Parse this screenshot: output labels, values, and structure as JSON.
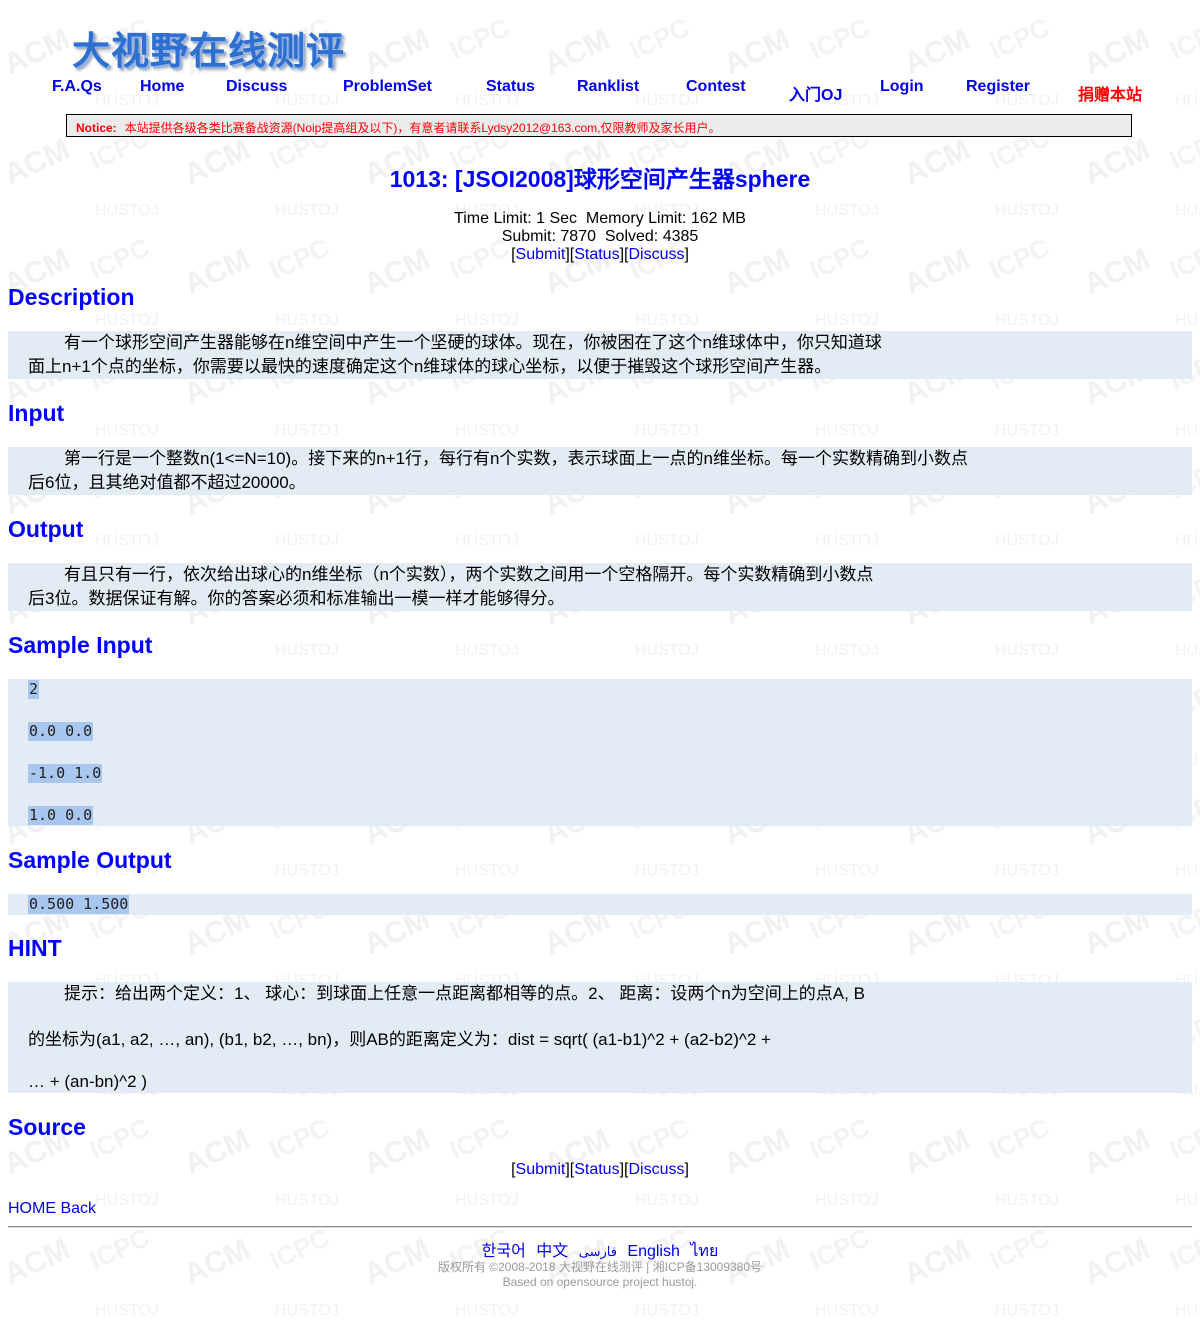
{
  "logo_text": "大视野在线测评",
  "nav": [
    {
      "label": "F.A.Qs"
    },
    {
      "label": "Home"
    },
    {
      "label": "Discuss"
    },
    {
      "label": "ProblemSet"
    },
    {
      "label": "Status"
    },
    {
      "label": "Ranklist"
    },
    {
      "label": "Contest"
    },
    {
      "label": "入门OJ"
    },
    {
      "label": "Login"
    },
    {
      "label": "Register"
    },
    {
      "label": "捐赠本站"
    }
  ],
  "notice": {
    "label": "Notice:",
    "text": "本站提供各级各类比赛备战资源(Noip提高组及以下)，有意者请联系Lydsy2012@163.com,仅限教师及家长用户。"
  },
  "problem": {
    "title": "1013: [JSOI2008]球形空间产生器sphere",
    "time_limit": "Time Limit: 1 Sec",
    "memory_limit": "Memory Limit: 162 MB",
    "submit": "Submit: 7870",
    "solved": "Solved: 4385"
  },
  "links": {
    "submit": "Submit",
    "status": "Status",
    "discuss": "Discuss"
  },
  "sections": {
    "description": {
      "heading": "Description",
      "line1": "有一个球形空间产生器能够在n维空间中产生一个坚硬的球体。现在，你被困在了这个n维球体中，你只知道球",
      "line2": "面上n+1个点的坐标，你需要以最快的速度确定这个n维球体的球心坐标，以便于摧毁这个球形空间产生器。"
    },
    "input": {
      "heading": "Input",
      "line1": "第一行是一个整数n(1<=N=10)。接下来的n+1行，每行有n个实数，表示球面上一点的n维坐标。每一个实数精确到小数点",
      "line2": "后6位，且其绝对值都不超过20000。"
    },
    "output": {
      "heading": "Output",
      "line1": "有且只有一行，依次给出球心的n维坐标（n个实数），两个实数之间用一个空格隔开。每个实数精确到小数点",
      "line2": "后3位。数据保证有解。你的答案必须和标准输出一模一样才能够得分。"
    },
    "sample_input": {
      "heading": "Sample Input",
      "lines": [
        "2",
        "0.0 0.0",
        "-1.0 1.0",
        "1.0 0.0"
      ]
    },
    "sample_output": {
      "heading": "Sample Output",
      "lines": [
        "0.500 1.500"
      ]
    },
    "hint": {
      "heading": "HINT",
      "line1": "提示：给出两个定义：1、 球心：到球面上任意一点距离都相等的点。2、 距离：设两个n为空间上的点A, B",
      "line2": "的坐标为(a1, a2, …, an), (b1, b2, …, bn)，则AB的距离定义为：dist = sqrt( (a1-b1)^2 + (a2-b2)^2 +",
      "line3": "… + (an-bn)^2 )"
    },
    "source": {
      "heading": "Source"
    }
  },
  "footer": {
    "home": "HOME",
    "back": "Back",
    "languages": [
      "한국어",
      "中文",
      "فارسی",
      "English",
      "ไทย"
    ],
    "copyright": "版权所有 ©2008-2018 大视野在线测评 | 湘ICP备13009380号",
    "based_on": "Based on opensource project hustoj."
  },
  "colors": {
    "link": "#0000ee",
    "heading": "#0000ff",
    "donate": "#ff0000",
    "section_bg": "#e3ecf5",
    "code_highlight": "#a9c6ee"
  }
}
